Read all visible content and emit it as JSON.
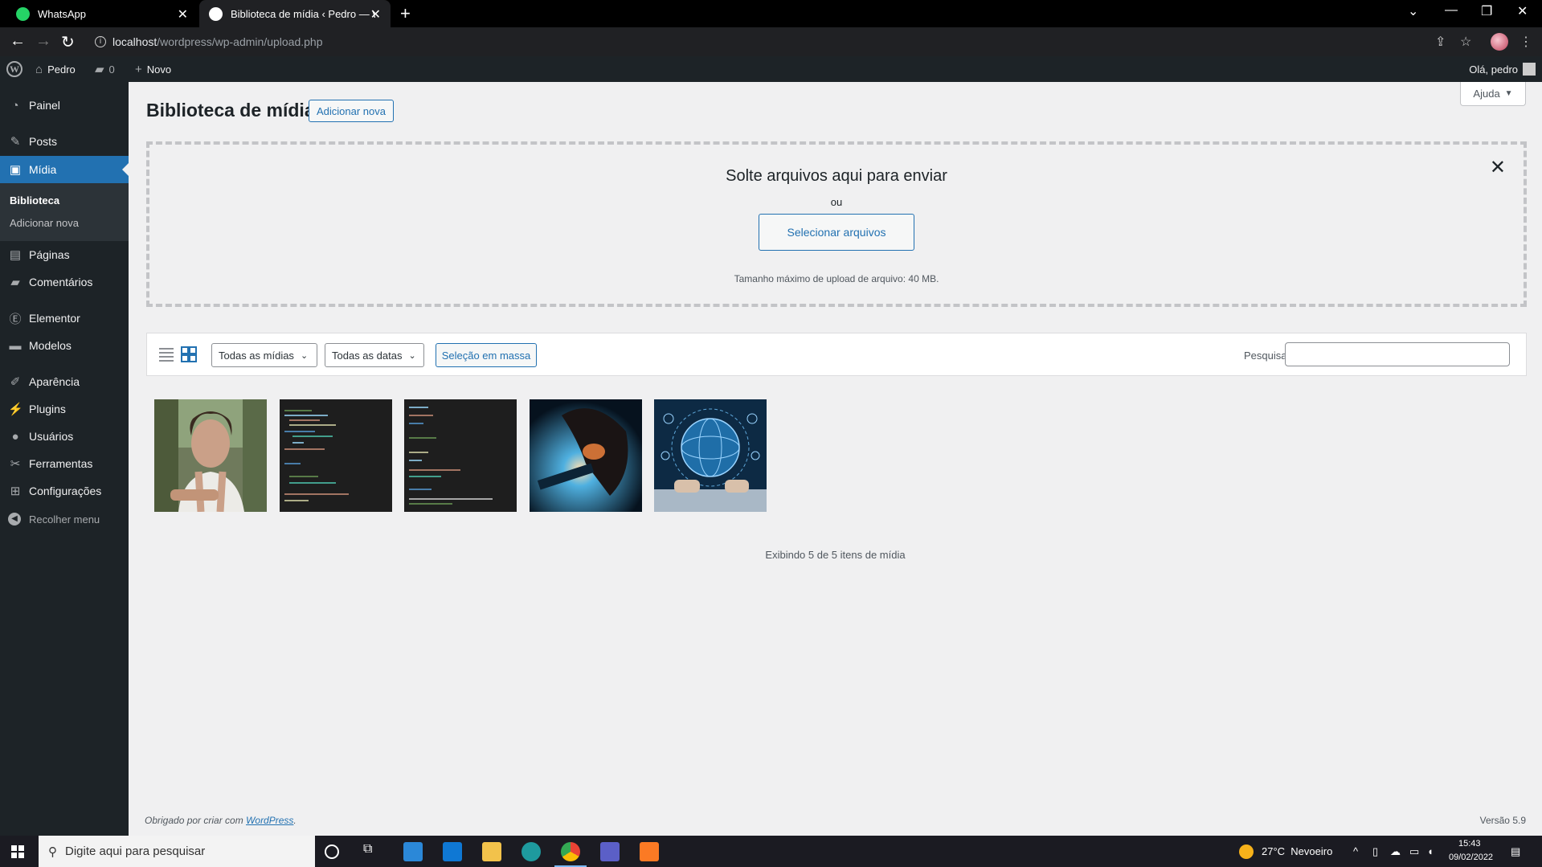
{
  "browser": {
    "tabs": [
      {
        "title": "WhatsApp"
      },
      {
        "title": "Biblioteca de mídia ‹ Pedro — W"
      }
    ],
    "url_host": "localhost",
    "url_path": "/wordpress/wp-admin/upload.php"
  },
  "adminbar": {
    "site_name": "Pedro",
    "comments_count": "0",
    "new_label": "Novo",
    "greeting": "Olá, pedro"
  },
  "sidebar": {
    "items": [
      {
        "label": "Painel",
        "icon": "dashboard-icon"
      },
      {
        "label": "Posts",
        "icon": "pin-icon"
      },
      {
        "label": "Mídia",
        "icon": "media-icon"
      },
      {
        "label": "Páginas",
        "icon": "pages-icon"
      },
      {
        "label": "Comentários",
        "icon": "comment-icon"
      },
      {
        "label": "Elementor",
        "icon": "elementor-icon"
      },
      {
        "label": "Modelos",
        "icon": "folder-icon"
      },
      {
        "label": "Aparência",
        "icon": "brush-icon"
      },
      {
        "label": "Plugins",
        "icon": "plugin-icon"
      },
      {
        "label": "Usuários",
        "icon": "user-icon"
      },
      {
        "label": "Ferramentas",
        "icon": "wrench-icon"
      },
      {
        "label": "Configurações",
        "icon": "settings-icon"
      }
    ],
    "submenu": {
      "library": "Biblioteca",
      "add_new": "Adicionar nova"
    },
    "collapse": "Recolher menu"
  },
  "main": {
    "title": "Biblioteca de mídia",
    "add_new": "Adicionar nova",
    "help": "Ajuda",
    "uploader": {
      "title": "Solte arquivos aqui para enviar",
      "or": "ou",
      "select_files": "Selecionar arquivos",
      "max_size": "Tamanho máximo de upload de arquivo: 40 MB."
    },
    "toolbar": {
      "media_filter": "Todas as mídias",
      "date_filter": "Todas as datas",
      "bulk_select": "Seleção em massa",
      "search_label": "Pesquisar",
      "search_value": ""
    },
    "showing": "Exibindo 5 de 5 itens de mídia",
    "footer_thanks": "Obrigado por criar com",
    "footer_link": "WordPress",
    "version": "Versão 5.9"
  },
  "taskbar": {
    "search_placeholder": "Digite aqui para pesquisar",
    "weather": "27°C  Nevoeiro",
    "time": "15:43",
    "date": "09/02/2022"
  },
  "colors": {
    "accent": "#2271b1",
    "sidebar": "#1d2327"
  }
}
